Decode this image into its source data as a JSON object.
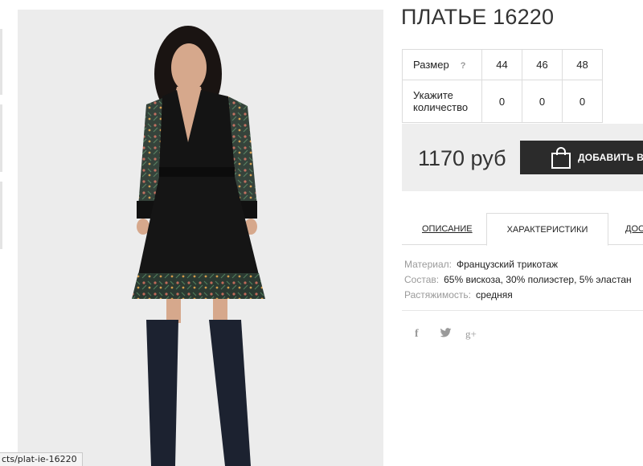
{
  "product": {
    "title": "ПЛАТЬЕ 16220"
  },
  "sizes": {
    "row_size_label": "Размер",
    "help_icon": "?",
    "values": [
      "44",
      "46",
      "48"
    ],
    "row_qty_label": "Укажите количество",
    "quantities": [
      "0",
      "0",
      "0"
    ]
  },
  "purchase": {
    "price": "1170 руб",
    "add_to_cart": "ДОБАВИТЬ В З",
    "button_color": "#2b2b2b",
    "icon": "shopping-bag-icon"
  },
  "tabs": [
    {
      "label": "ОПИСАНИЕ"
    },
    {
      "label": "ХАРАКТЕРИСТИКИ"
    },
    {
      "label": "ДОС"
    }
  ],
  "characteristics": [
    {
      "key": "Материал:",
      "value": "Французский трикотаж"
    },
    {
      "key": "Состав:",
      "value": "65% вискоза, 30% полиэстер, 5% эластан"
    },
    {
      "key": "Растяжимость:",
      "value": "средняя"
    }
  ],
  "social": [
    {
      "icon": "facebook-icon",
      "glyph": "f"
    },
    {
      "icon": "twitter-icon",
      "glyph": "t"
    },
    {
      "icon": "google-plus-icon",
      "glyph": "g+"
    }
  ],
  "status_bar": {
    "url": "cts/plat-ie-16220"
  }
}
